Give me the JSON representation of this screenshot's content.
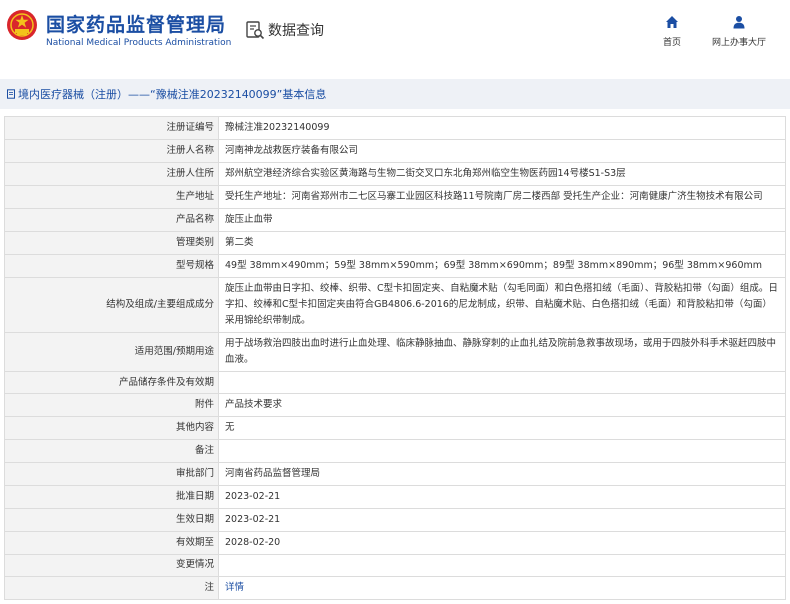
{
  "header": {
    "brand_cn": "国家药品监督管理局",
    "brand_en": "National Medical Products Administration",
    "query_label": "数据查询",
    "nav": [
      {
        "label": "首页",
        "icon": "home-icon"
      },
      {
        "label": "网上办事大厅",
        "icon": "user-icon"
      }
    ]
  },
  "breadcrumb": {
    "text": "境内医疗器械（注册）——“豫械注准20232140099”基本信息",
    "icon": "document-icon"
  },
  "colors": {
    "brand_blue": "#1b4ea3",
    "bar_bg": "#eef1f6",
    "label_bg": "#f3f3f3",
    "border": "#dcdcdc"
  },
  "rows": [
    {
      "label": "注册证编号",
      "value": "豫械注准20232140099"
    },
    {
      "label": "注册人名称",
      "value": "河南神龙战救医疗装备有限公司"
    },
    {
      "label": "注册人住所",
      "value": "郑州航空港经济综合实验区黄海路与生物二街交叉口东北角郑州临空生物医药园14号楼S1-S3层"
    },
    {
      "label": "生产地址",
      "value": "受托生产地址：河南省郑州市二七区马寨工业园区科技路11号院南厂房二楼西部 受托生产企业：河南健康广济生物技术有限公司"
    },
    {
      "label": "产品名称",
      "value": "旋压止血带"
    },
    {
      "label": "管理类别",
      "value": "第二类"
    },
    {
      "label": "型号规格",
      "value": "49型 38mm×490mm；59型 38mm×590mm；69型 38mm×690mm；89型 38mm×890mm；96型 38mm×960mm"
    },
    {
      "label": "结构及组成/主要组成成分",
      "value": "旋压止血带由日字扣、绞棒、织带、C型卡扣固定夹、自粘魔术贴（勾毛同面）和白色搭扣绒（毛面）、背胶粘扣带（勾面）组成。日字扣、绞棒和C型卡扣固定夹由符合GB4806.6-2016的尼龙制成，织带、自粘魔术贴、白色搭扣绒（毛面）和背胶粘扣带（勾面）采用锦纶织带制成。"
    },
    {
      "label": "适用范围/预期用途",
      "value": "用于战场救治四肢出血时进行止血处理、临床静脉抽血、静脉穿刺的止血扎结及院前急救事故现场，或用于四肢外科手术驱赶四肢中血液。"
    },
    {
      "label": "产品储存条件及有效期",
      "value": ""
    },
    {
      "label": "附件",
      "value": "产品技术要求"
    },
    {
      "label": "其他内容",
      "value": "无"
    },
    {
      "label": "备注",
      "value": ""
    },
    {
      "label": "审批部门",
      "value": "河南省药品监督管理局"
    },
    {
      "label": "批准日期",
      "value": "2023-02-21"
    },
    {
      "label": "生效日期",
      "value": "2023-02-21"
    },
    {
      "label": "有效期至",
      "value": "2028-02-20"
    },
    {
      "label": "变更情况",
      "value": ""
    },
    {
      "label": "注",
      "value": "详情"
    }
  ]
}
